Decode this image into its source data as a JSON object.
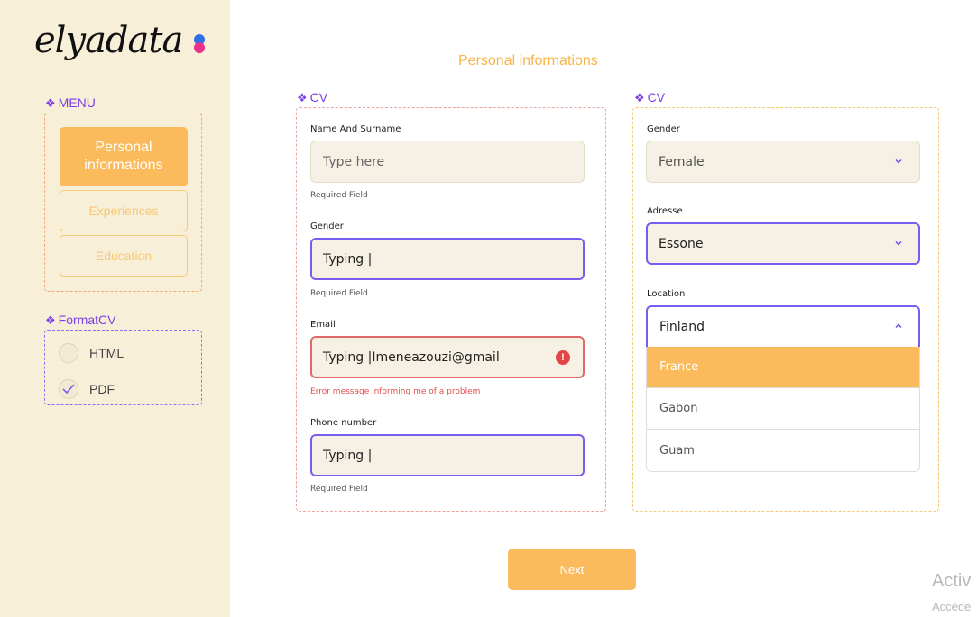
{
  "brand": {
    "logo_text": "elyadata"
  },
  "sidebar": {
    "menu_label": "MENU",
    "menu_items": [
      {
        "label": "Personal informations",
        "active": true
      },
      {
        "label": "Experiences",
        "active": false
      },
      {
        "label": "Education",
        "active": false
      }
    ],
    "format_label": "FormatCV",
    "format_options": [
      {
        "label": "HTML",
        "checked": false
      },
      {
        "label": "PDF",
        "checked": true
      }
    ]
  },
  "main": {
    "title": "Personal informations",
    "left_section": {
      "label": "CV",
      "fields": [
        {
          "label": "Name And Surname",
          "value": "Type here",
          "helper": "Required Field",
          "state": "placeholder"
        },
        {
          "label": "Gender",
          "value": "Typing |",
          "helper": "Required Field",
          "state": "focus"
        },
        {
          "label": "Email",
          "value": "Typing |Imeneazouzi@gmail",
          "helper": "Error message informing me of a problem",
          "state": "error"
        },
        {
          "label": "Phone number",
          "value": "Typing |",
          "helper": "Required Field",
          "state": "focus"
        }
      ]
    },
    "right_section": {
      "label": "CV",
      "fields": [
        {
          "label": "Gender",
          "value": "Female",
          "state": "default"
        },
        {
          "label": "Adresse",
          "value": "Essone",
          "state": "focus"
        },
        {
          "label": "Location",
          "value": "Finland",
          "state": "open"
        }
      ],
      "location_options": [
        {
          "label": "France",
          "highlighted": true
        },
        {
          "label": "Gabon",
          "highlighted": false
        },
        {
          "label": "Guam",
          "highlighted": false
        }
      ]
    },
    "next_label": "Next"
  },
  "watermark": {
    "line1": "Activ",
    "line2": "Accéde"
  },
  "colors": {
    "accent": "#fbbb5c",
    "sidebar_bg": "#f8efd9",
    "focus": "#7b5cf0",
    "error": "#e24545",
    "section_label": "#7b3fe4"
  },
  "icons": [
    "diamond-icon",
    "chevron-down-icon",
    "chevron-up-icon",
    "error-icon",
    "check-icon"
  ]
}
